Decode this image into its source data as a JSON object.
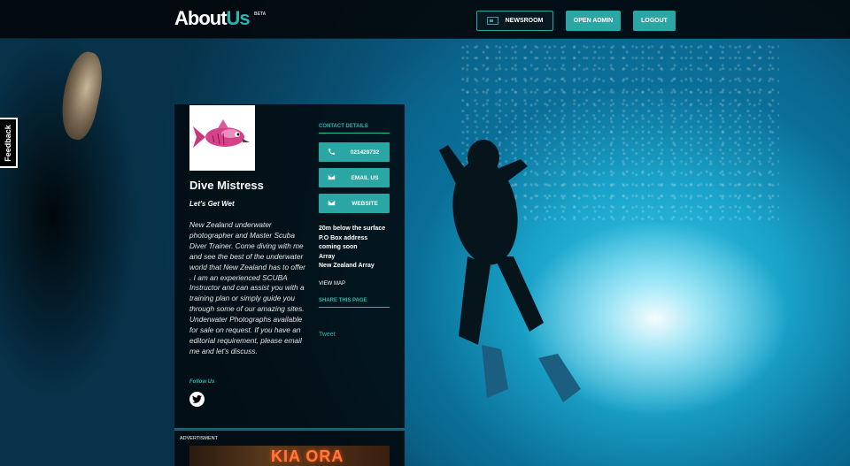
{
  "header": {
    "logo_about": "About",
    "logo_us": "Us",
    "logo_beta": "BETA",
    "buttons": {
      "newsroom": "NEWSROOM",
      "open_admin": "OPEN ADMIN",
      "logout": "LOGOUT"
    }
  },
  "feedback_tab": "Feedback",
  "profile": {
    "name": "Dive Mistress",
    "tagline": "Let's Get Wet",
    "description": "New Zealand underwater photographer and Master Scuba Diver Trainer. Come diving with me and see the best of the underwater world that New Zealand has to offer . I am an experienced SCUBA Instructor and can assist you with a training plan or simply guide you through some of our amazing sites. Underwater Photographs available for sale on request. If you have an editorial requirement, please email me and let's discuss.",
    "follow_label": "Follow Us"
  },
  "contact": {
    "title": "CONTACT DETAILS",
    "phone": "021429732",
    "email_label": "EMAIL US",
    "website_label": "WEBSITE",
    "address_line1": "20m below the surface P.O Box address coming soon",
    "address_line2": "Array",
    "address_line3": "New Zealand Array",
    "view_map": "VIEW MAP"
  },
  "share": {
    "title": "SHARE THIS PAGE",
    "tweet": "Tweet"
  },
  "advert": {
    "label": "ADVERTISMENT",
    "image_text": "KIA ORA"
  },
  "colors": {
    "accent": "#2aa7a4",
    "header_bg": "#03080c",
    "card_bg": "#020a0f"
  }
}
